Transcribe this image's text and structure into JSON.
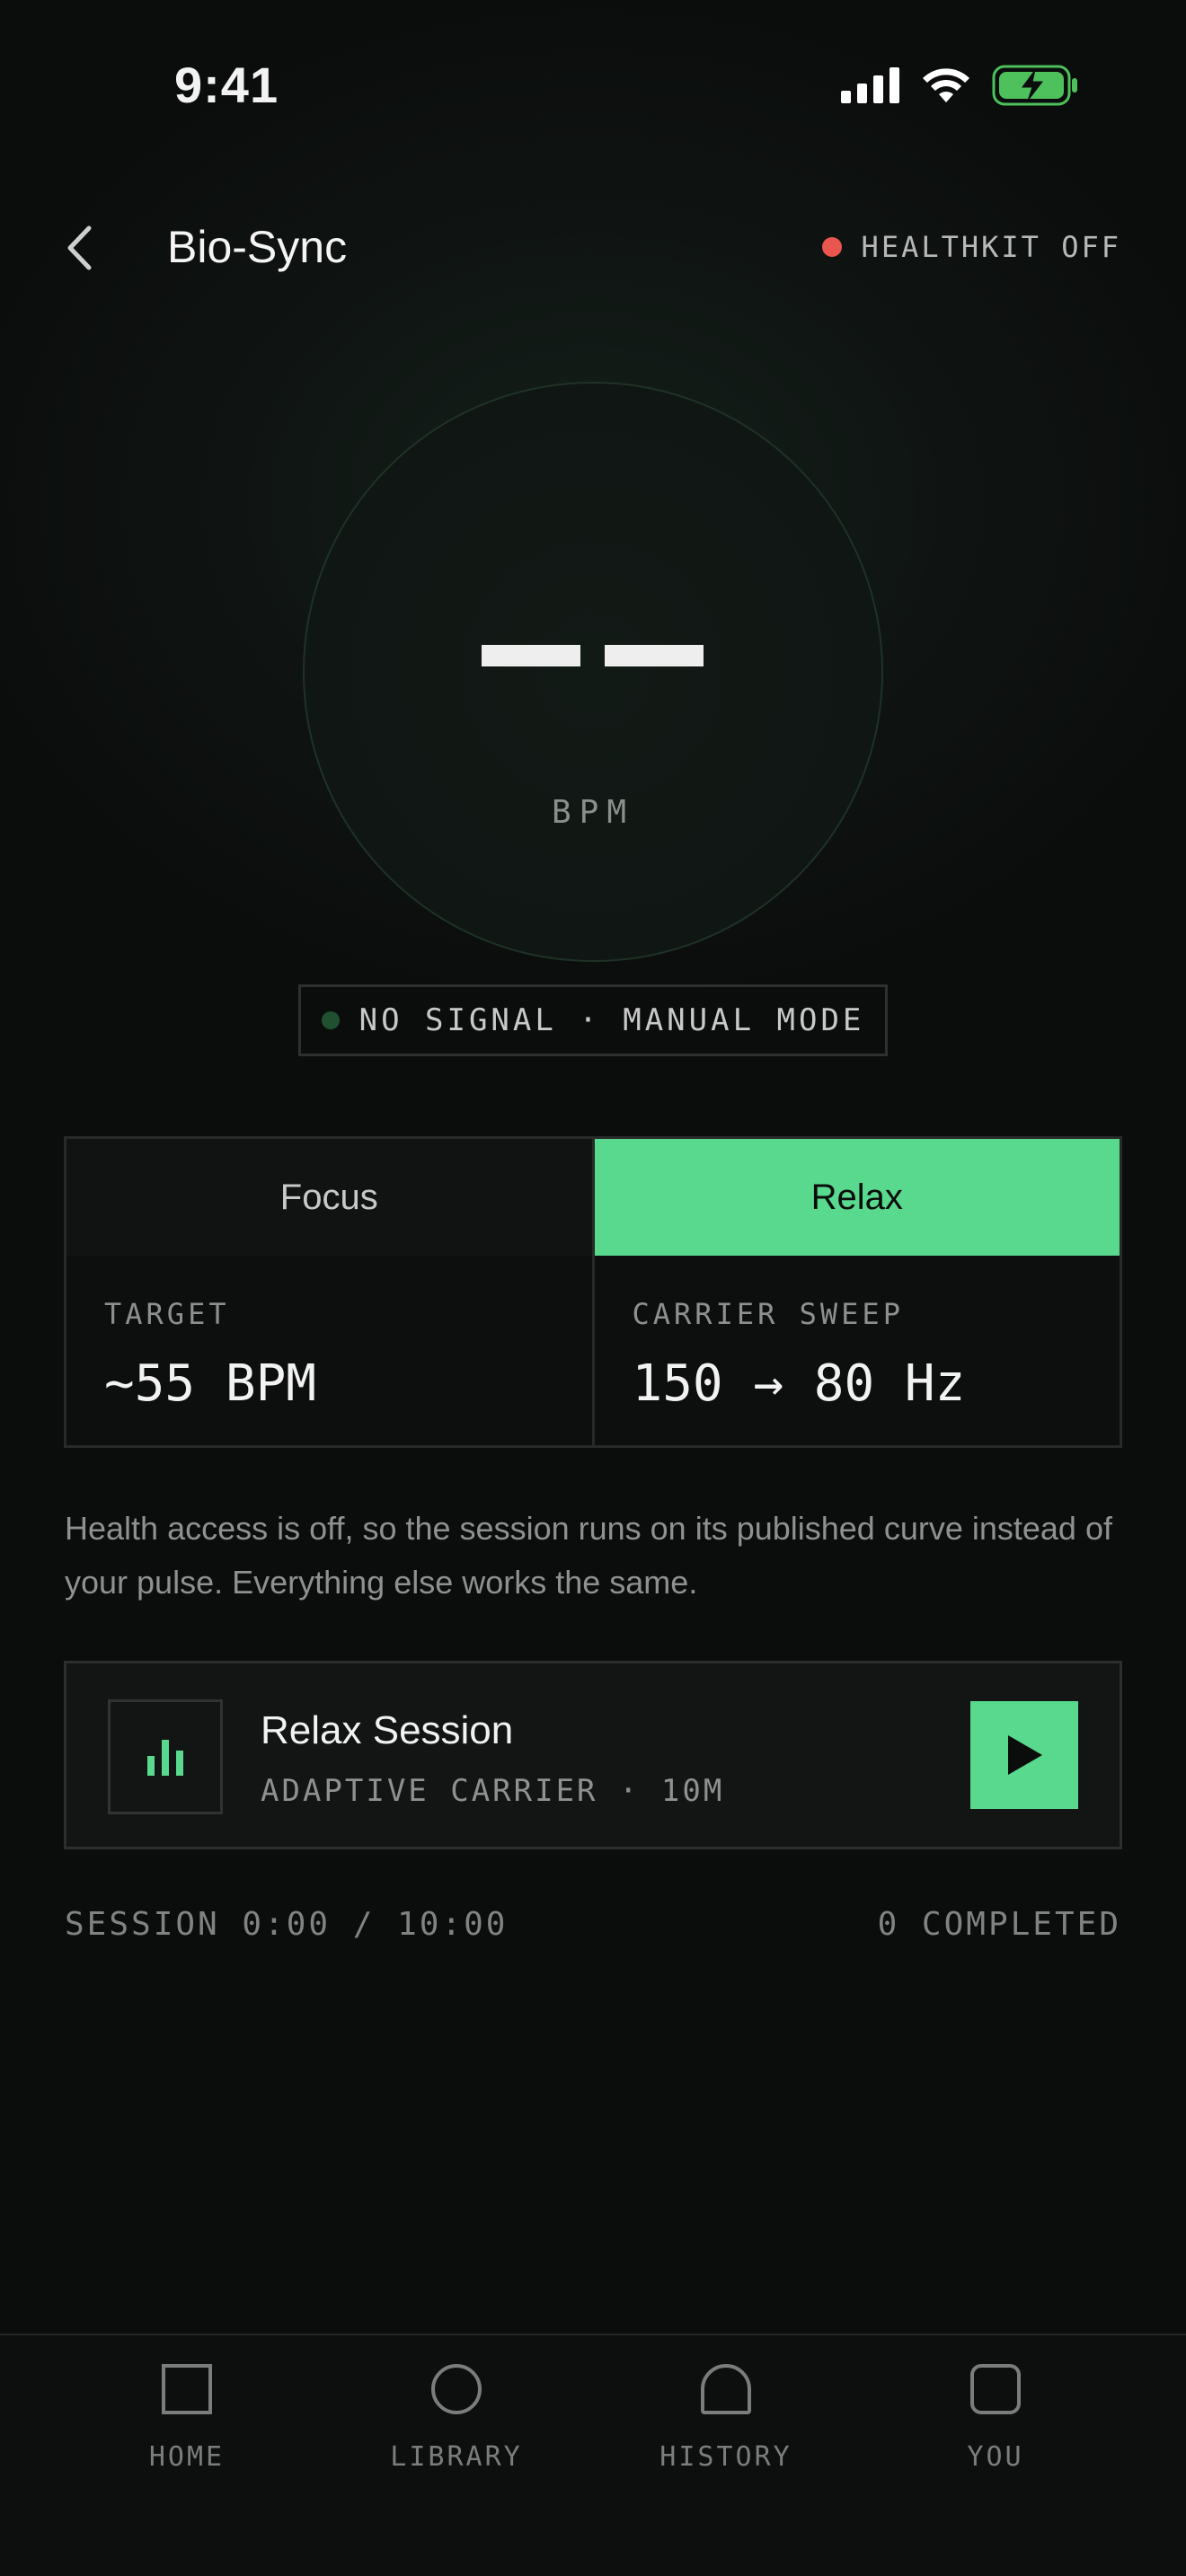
{
  "status": {
    "time": "9:41"
  },
  "header": {
    "title": "Bio-Sync",
    "healthkit": "HEALTHKIT OFF"
  },
  "ring": {
    "unit": "BPM"
  },
  "signal": {
    "text": "NO SIGNAL · MANUAL MODE"
  },
  "modes": {
    "focus": "Focus",
    "relax": "Relax",
    "selected": "Relax"
  },
  "metrics": {
    "target_label": "TARGET",
    "target_value": "~55 BPM",
    "sweep_label": "CARRIER SWEEP",
    "sweep_value": "150 → 80 Hz"
  },
  "note": "Health access is off, so the session runs on its published curve instead of your pulse. Everything else works the same.",
  "session": {
    "title": "Relax Session",
    "subtitle": "ADAPTIVE CARRIER · 10M",
    "progress": "SESSION 0:00 / 10:00",
    "completed": "0 COMPLETED"
  },
  "tabs": [
    {
      "label": "HOME",
      "icon": "square-icon"
    },
    {
      "label": "LIBRARY",
      "icon": "circle-icon"
    },
    {
      "label": "HISTORY",
      "icon": "arch-icon"
    },
    {
      "label": "YOU",
      "icon": "rounded-square-icon"
    }
  ],
  "colors": {
    "accent": "#58d98e",
    "alert": "#e8564f",
    "background": "#0b0d0c"
  }
}
